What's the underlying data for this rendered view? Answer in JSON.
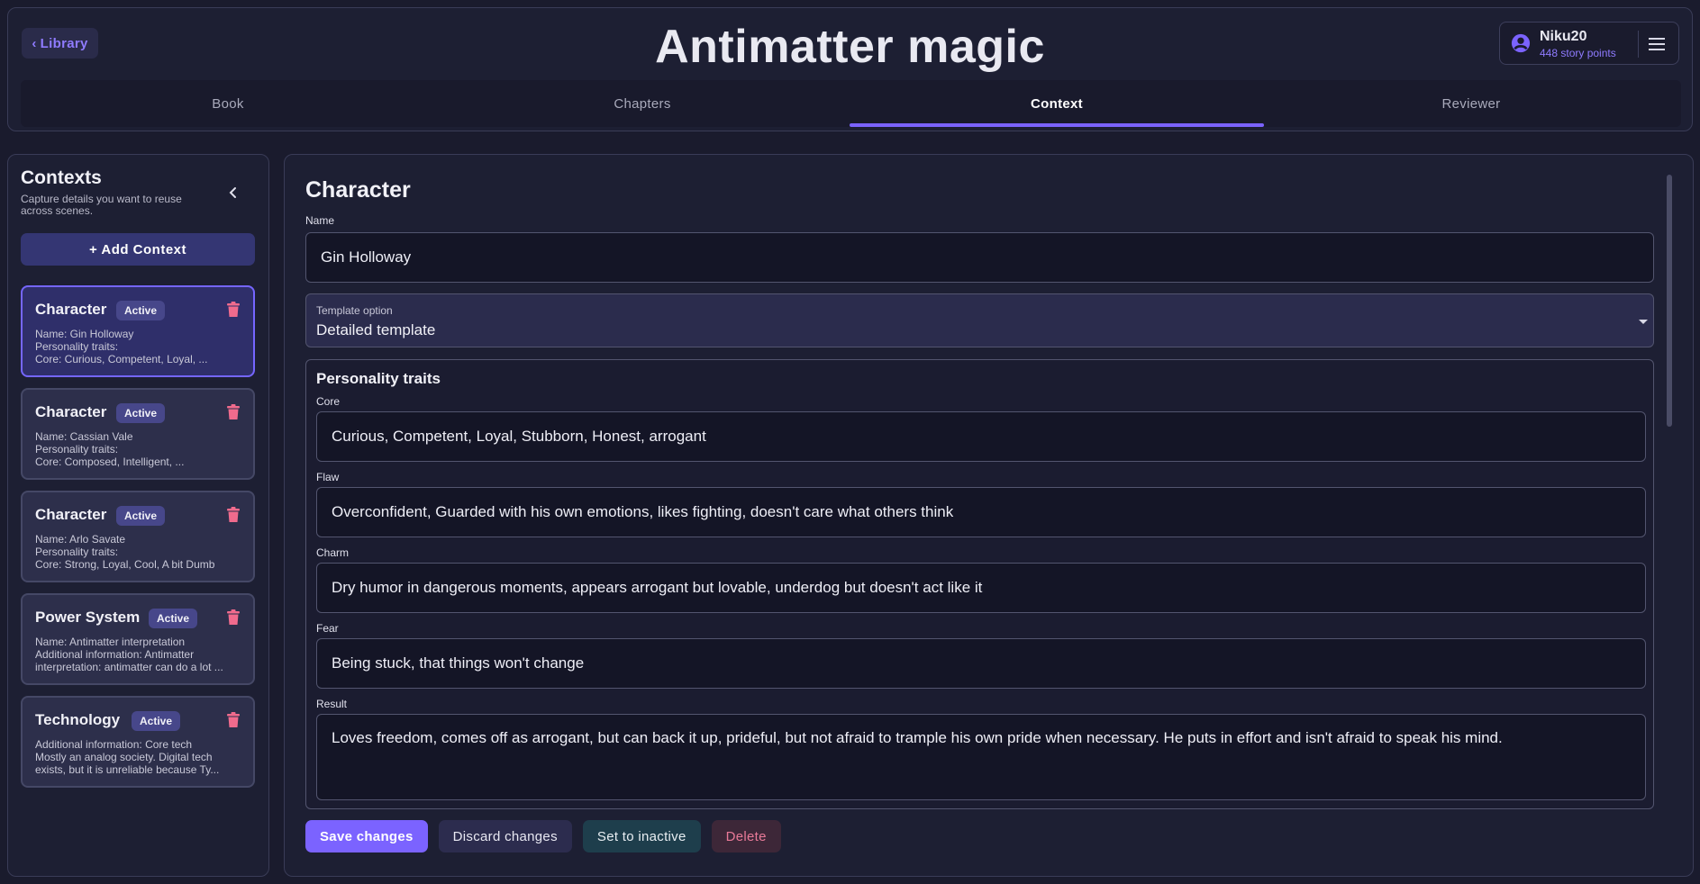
{
  "header": {
    "back_label": "Library",
    "title": "Antimatter magic",
    "user": {
      "name": "Niku20",
      "points": "448 story points"
    }
  },
  "tabs": [
    {
      "label": "Book",
      "active": false
    },
    {
      "label": "Chapters",
      "active": false
    },
    {
      "label": "Context",
      "active": true
    },
    {
      "label": "Reviewer",
      "active": false
    }
  ],
  "sidebar": {
    "title": "Contexts",
    "subtitle": "Capture details you want to reuse across scenes.",
    "add_label": "+ Add Context",
    "cards": [
      {
        "title": "Character",
        "badge": "Active",
        "lines": [
          "Name: Gin Holloway",
          "Personality traits:",
          "Core: Curious, Competent, Loyal, ..."
        ]
      },
      {
        "title": "Character",
        "badge": "Active",
        "lines": [
          "Name: Cassian Vale",
          "Personality traits:",
          "Core: Composed, Intelligent, ..."
        ]
      },
      {
        "title": "Character",
        "badge": "Active",
        "lines": [
          "Name: Arlo Savate",
          "Personality traits:",
          "Core: Strong, Loyal, Cool, A bit Dumb"
        ]
      },
      {
        "title": "Power System",
        "badge": "Active",
        "lines": [
          "Name: Antimatter interpretation",
          "Additional information: Antimatter",
          "interpretation: antimatter can do a lot ..."
        ]
      },
      {
        "title": "Technology",
        "badge": "Active",
        "lines": [
          "Additional information: Core tech",
          "Mostly an analog society. Digital tech",
          "exists, but it is unreliable because Ty..."
        ]
      }
    ]
  },
  "editor": {
    "title": "Character",
    "name_label": "Name",
    "name_value": "Gin Holloway",
    "template_label": "Template option",
    "template_value": "Detailed template",
    "traits_title": "Personality traits",
    "core_label": "Core",
    "core_value": "Curious, Competent, Loyal, Stubborn, Honest, arrogant",
    "flaw_label": "Flaw",
    "flaw_value": "Overconfident, Guarded with his own emotions, likes fighting, doesn't care what others think",
    "charm_label": "Charm",
    "charm_value": "Dry humor in dangerous moments, appears arrogant but lovable, underdog but doesn't act like it",
    "fear_label": "Fear",
    "fear_value": "Being stuck, that things won't change",
    "result_label": "Result",
    "result_value": "Loves freedom, comes off as arrogant, but can back it up, prideful, but not afraid to trample his own pride when necessary. He puts in effort and isn't afraid to speak his mind."
  },
  "actions": {
    "save": "Save changes",
    "discard": "Discard changes",
    "inactive": "Set to inactive",
    "delete": "Delete"
  },
  "colors": {
    "accent": "#7b63ff",
    "background": "#1a1b2d",
    "delete_icon": "#f06b8d"
  }
}
